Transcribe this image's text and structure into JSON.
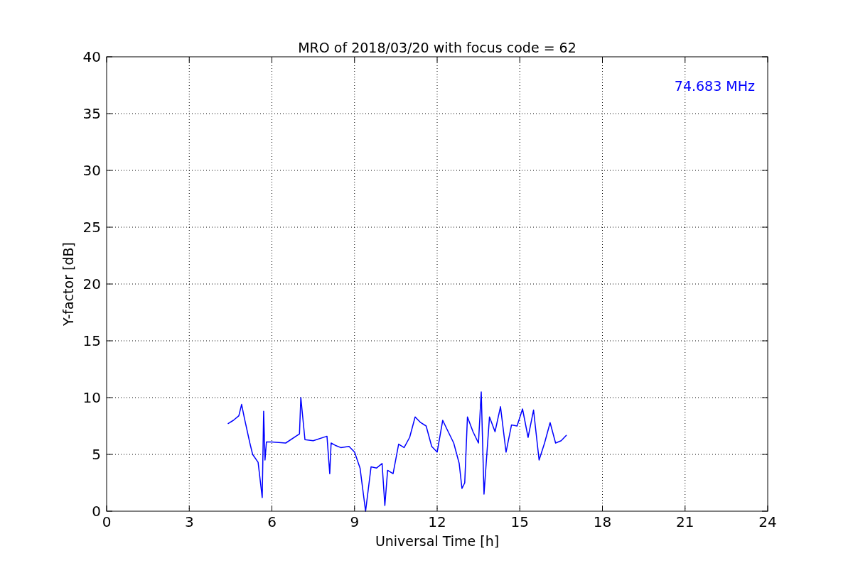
{
  "chart_data": {
    "type": "line",
    "title": "MRO of 2018/03/20 with focus code = 62",
    "xlabel": "Universal Time [h]",
    "ylabel": "Y-factor [dB]",
    "x": [
      4.4,
      4.6,
      4.8,
      4.9,
      5.0,
      5.2,
      5.3,
      5.5,
      5.65,
      5.7,
      5.75,
      5.8,
      6.0,
      6.5,
      7.0,
      7.05,
      7.2,
      7.5,
      8.0,
      8.1,
      8.15,
      8.3,
      8.5,
      8.8,
      9.0,
      9.2,
      9.4,
      9.6,
      9.8,
      10.0,
      10.1,
      10.2,
      10.4,
      10.6,
      10.8,
      11.0,
      11.2,
      11.4,
      11.6,
      11.8,
      12.0,
      12.2,
      12.4,
      12.6,
      12.8,
      12.9,
      13.0,
      13.1,
      13.3,
      13.5,
      13.6,
      13.7,
      13.9,
      14.1,
      14.3,
      14.5,
      14.7,
      14.9,
      15.1,
      15.3,
      15.5,
      15.7,
      15.9,
      16.1,
      16.3,
      16.5,
      16.7
    ],
    "series": [
      {
        "name": "74.683 MHz",
        "color": "#0000ff",
        "values": [
          7.7,
          8.0,
          8.4,
          9.4,
          8.2,
          6.0,
          5.0,
          4.3,
          1.2,
          8.8,
          4.5,
          6.1,
          6.1,
          6.0,
          6.8,
          10.0,
          6.3,
          6.2,
          6.6,
          3.3,
          6.0,
          5.8,
          5.6,
          5.7,
          5.2,
          3.8,
          0.0,
          3.9,
          3.8,
          4.2,
          0.5,
          3.6,
          3.3,
          5.9,
          5.6,
          6.5,
          8.3,
          7.8,
          7.5,
          5.7,
          5.2,
          8.0,
          7.0,
          6.0,
          4.2,
          2.0,
          2.5,
          8.3,
          7.0,
          6.0,
          10.5,
          1.5,
          8.3,
          7.0,
          9.2,
          5.2,
          7.6,
          7.5,
          9.0,
          6.5,
          8.9,
          4.5,
          6.0,
          7.8,
          6.0,
          6.2,
          6.7
        ]
      }
    ],
    "xlim": [
      0,
      24
    ],
    "ylim": [
      0,
      40
    ],
    "xticks": [
      0,
      3,
      6,
      9,
      12,
      15,
      18,
      21,
      24
    ],
    "yticks": [
      0,
      5,
      10,
      15,
      20,
      25,
      30,
      35,
      40
    ],
    "grid": true
  }
}
